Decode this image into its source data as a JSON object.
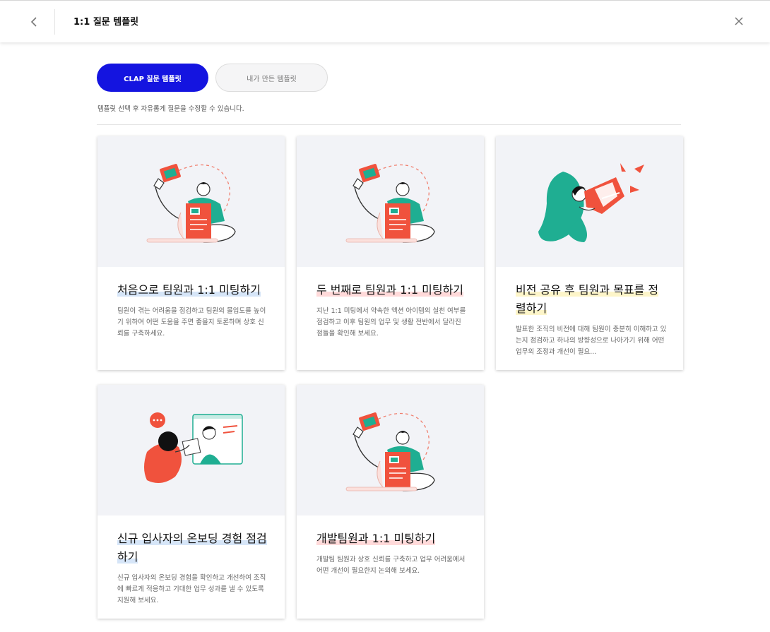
{
  "header": {
    "title": "1:1 질문 템플릿",
    "back_icon": "chevron-left-icon",
    "close_icon": "close-icon"
  },
  "tabs": [
    {
      "label": "CLAP 질문 템플릿",
      "active": true
    },
    {
      "label": "내가 만든 템플릿",
      "active": false
    }
  ],
  "hint": "템플릿 선택 후 자유롭게 질문을 수정할 수 있습니다.",
  "colors": {
    "accent": "#1414e0",
    "illustration_red": "#f0523d",
    "illustration_teal": "#1fae92",
    "card_illustration_bg": "#f2f3f7"
  },
  "cards": [
    {
      "title": "처음으로 팀원과 1:1 미팅하기",
      "description": "팀원이 겪는 어려움을 점검하고 팀원의 몰입도를 높이기 위하여 어떤 도움을 주면 좋을지 토론하며 상호 신뢰를 구축하세요.",
      "illustration": "person-holding-document-illustration"
    },
    {
      "title": "두 번째로 팀원과 1:1 미팅하기",
      "description": "지난 1:1 미팅에서 약속한 액션 아이템의 실천 여부를 점검하고 이후 팀원의 업무 및 생활 전반에서 달라진 점들을 확인해 보세요.",
      "illustration": "person-holding-document-illustration"
    },
    {
      "title": "비전 공유 후 팀원과 목표를 정렬하기",
      "description": "발표한 조직의 비전에 대해 팀원이 충분히 이해하고 있는지 점검하고 하나의 방향성으로 나아가기 위해 어떤 업무의 조정과 개선이 필요...",
      "illustration": "person-with-megaphone-illustration"
    },
    {
      "title": "신규 입사자의 온보딩 경험 점검하기",
      "description": "신규 입사자의 온보딩 경험을 확인하고 개선하여 조직에 빠르게 적응하고 기대한 업무 성과를 낼 수 있도록 지원해 보세요.",
      "illustration": "video-call-illustration"
    },
    {
      "title": "개발팀원과 1:1 미팅하기",
      "description": "개발팀 팀원과 상호 신뢰를 구축하고 업무 어려움에서 어떤 개선이 필요한지 논의해 보세요.",
      "illustration": "person-holding-document-illustration"
    }
  ]
}
